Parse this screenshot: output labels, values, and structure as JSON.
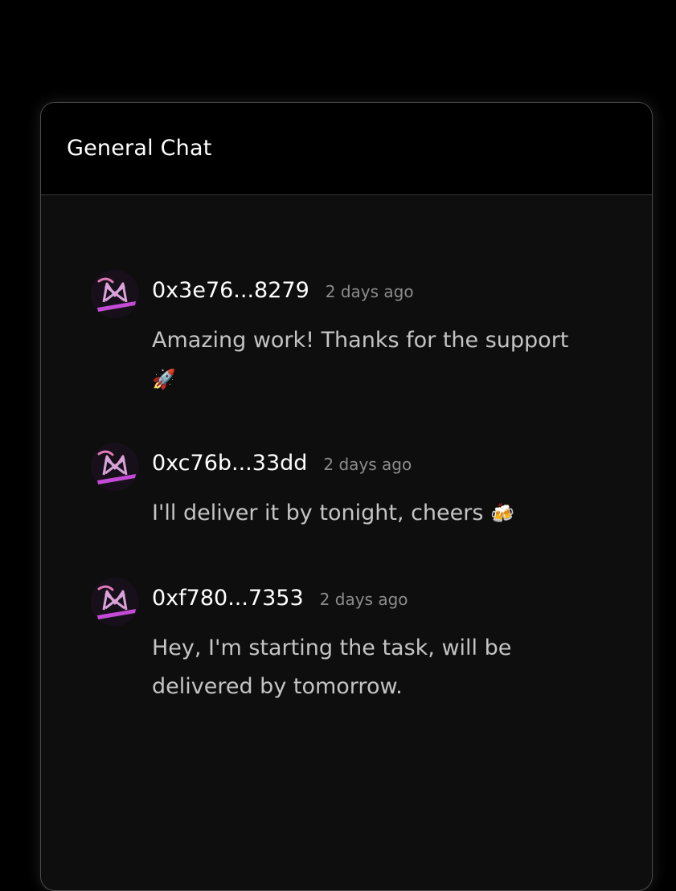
{
  "chat": {
    "title": "General Chat"
  },
  "messages": [
    {
      "author": "0x3e76...8279",
      "time": "2 days ago",
      "text": "Amazing work! Thanks for the support",
      "emoji": "🚀"
    },
    {
      "author": "0xc76b...33dd",
      "time": "2 days ago",
      "text": "I'll deliver it by tonight, cheers",
      "emoji": "🍻"
    },
    {
      "author": "0xf780...7353",
      "time": "2 days ago",
      "text": "Hey, I'm starting the task, will be delivered by tomorrow.",
      "emoji": ""
    }
  ],
  "colors": {
    "background": "#000000",
    "panel": "#0e0e0e",
    "header": "#000000",
    "author": "#ffffff",
    "timestamp": "#8c8c8c",
    "message_text": "#c4c4c4",
    "avatar_accent": "#c44bd6"
  },
  "icons": {
    "avatar": "avatar-logo-icon"
  }
}
